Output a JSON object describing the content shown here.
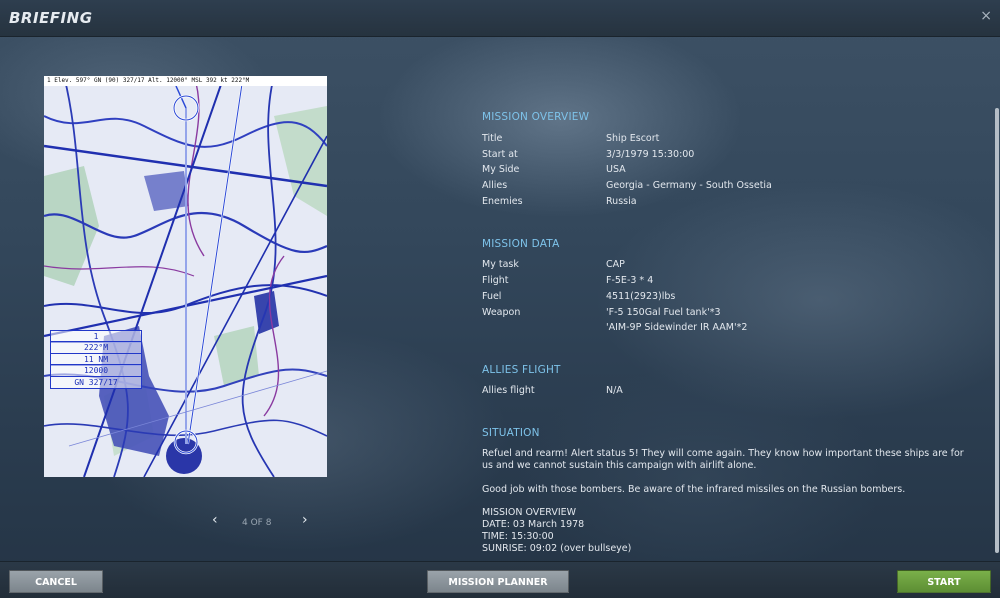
{
  "window": {
    "title": "BRIEFING",
    "close_glyph": "×"
  },
  "map": {
    "header": "1  Elev. 597°   GN (90)  327/17    Alt. 12000° MSL    392 kt    222°M",
    "waypoint_box": [
      "1",
      "222°M",
      "11 NM",
      "12000",
      "GN  327/17"
    ],
    "waypoint_labels": [
      "1",
      "2"
    ]
  },
  "pager": {
    "prev_glyph": "‹",
    "next_glyph": "›",
    "label": "4 OF 8"
  },
  "sections": {
    "overview": {
      "title": "MISSION OVERVIEW",
      "rows": [
        {
          "k": "Title",
          "v": "Ship Escort"
        },
        {
          "k": "Start at",
          "v": "3/3/1979  15:30:00"
        },
        {
          "k": "My Side",
          "v": "USA"
        },
        {
          "k": "Allies",
          "v": "Georgia - Germany - South Ossetia"
        },
        {
          "k": "Enemies",
          "v": "Russia"
        }
      ]
    },
    "data": {
      "title": "MISSION DATA",
      "rows": [
        {
          "k": "My task",
          "v": "CAP"
        },
        {
          "k": "Flight",
          "v": "F-5E-3 * 4"
        },
        {
          "k": "Fuel",
          "v": "4511(2923)lbs"
        },
        {
          "k": "Weapon",
          "v": "'F-5 150Gal Fuel tank'*3"
        },
        {
          "k": "",
          "v": "'AIM-9P Sidewinder IR AAM'*2"
        }
      ]
    },
    "allies": {
      "title": "ALLIES FLIGHT",
      "rows": [
        {
          "k": "Allies flight",
          "v": "N/A"
        }
      ]
    },
    "situation": {
      "title": "SITUATION",
      "paragraphs": [
        "Refuel and rearm! Alert status 5!  They will come again. They know how important these ships are for us and we cannot sustain this campaign with airlift alone.",
        "Good job with those bombers. Be aware of the infrared missiles on the Russian bombers.",
        "MISSION OVERVIEW",
        "DATE: 03 March 1978",
        "TIME: 15:30:00",
        "SUNRISE: 09:02 (over bullseye)"
      ]
    }
  },
  "footer": {
    "cancel": "CANCEL",
    "planner": "MISSION PLANNER",
    "start": "START"
  },
  "colors": {
    "accent": "#7ec3ea",
    "start_button": "#6ea040",
    "map_ink": "#1b2fb8"
  }
}
